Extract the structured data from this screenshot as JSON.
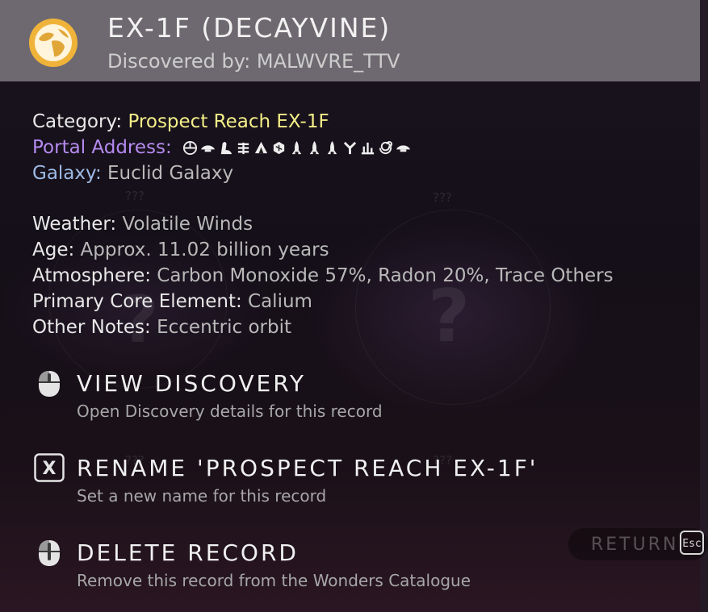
{
  "header": {
    "title": "EX-1F (DECAYVINE)",
    "subtitle": "Discovered by: MALWVRE_TTV",
    "icon": "planet-icon",
    "icon_color": "#f0b33a"
  },
  "info": {
    "category_label": "Category:",
    "category_value": "Prospect Reach EX-1F",
    "portal_label": "Portal Address:",
    "portal_glyphs": [
      "sunset",
      "bird",
      "diplo",
      "bug",
      "tent",
      "hexagon",
      "rocket",
      "rocket",
      "rocket",
      "tree",
      "atlas",
      "spiral",
      "bird"
    ],
    "galaxy_label": "Galaxy:",
    "galaxy_value": "Euclid Galaxy",
    "weather_label": "Weather:",
    "weather_value": "Volatile Winds",
    "age_label": "Age:",
    "age_value": "Approx. 11.02 billion years",
    "atmosphere_label": "Atmosphere:",
    "atmosphere_value": "Carbon Monoxide 57%, Radon 20%, Trace Others",
    "core_label": "Primary Core Element:",
    "core_value": "Calium",
    "notes_label": "Other Notes:",
    "notes_value": "Eccentric orbit"
  },
  "actions": [
    {
      "title": "VIEW DISCOVERY",
      "description": "Open Discovery details for this record",
      "icon": "mouse-left-icon"
    },
    {
      "title": "RENAME 'PROSPECT REACH EX-1F'",
      "description": "Set a new name for this record",
      "icon": "x-key-icon",
      "key": "X"
    },
    {
      "title": "DELETE RECORD",
      "description": "Remove this record from the Wonders Catalogue",
      "icon": "mouse-hold-icon"
    }
  ],
  "background": {
    "unknown_tags": [
      "???",
      "???",
      "???",
      "???"
    ]
  },
  "return": {
    "label": "RETURN",
    "key": "Esc"
  },
  "colors": {
    "category_value": "#f4ef88",
    "portal_label": "#b58bf0",
    "galaxy_label": "#9fbbe6",
    "header_bg": "#6e6970"
  }
}
